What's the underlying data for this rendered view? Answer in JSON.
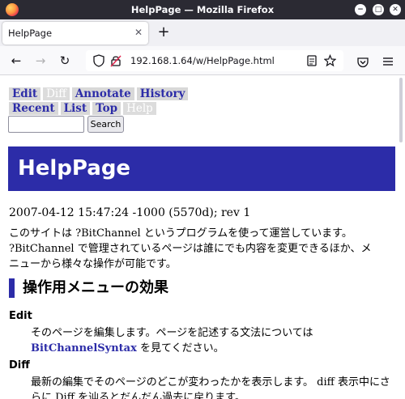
{
  "window": {
    "title": "HelpPage — Mozilla Firefox",
    "minimize_glyph": "−",
    "maximize_glyph": "□",
    "close_glyph": "✕"
  },
  "tabs": [
    {
      "label": "HelpPage",
      "close_glyph": "✕",
      "active": true
    }
  ],
  "new_tab_glyph": "+",
  "nav": {
    "back_glyph": "←",
    "forward_glyph": "→",
    "reload_glyph": "↻",
    "url": "192.168.1.64/w/HelpPage.html"
  },
  "menu": {
    "row1": [
      {
        "label": "Edit",
        "enabled": true
      },
      {
        "label": "Diff",
        "enabled": false
      },
      {
        "label": "Annotate",
        "enabled": true
      },
      {
        "label": "History",
        "enabled": true
      }
    ],
    "row2": [
      {
        "label": "Recent",
        "enabled": true
      },
      {
        "label": "List",
        "enabled": true
      },
      {
        "label": "Top",
        "enabled": true
      },
      {
        "label": "Help",
        "enabled": false
      }
    ]
  },
  "search": {
    "value": "",
    "button_label": "Search"
  },
  "page": {
    "heading": "HelpPage",
    "meta": "2007-04-12 15:47:24 -1000 (5570d); rev 1",
    "intro_line1": "このサイトは ?BitChannel というプログラムを使って運営しています。",
    "intro_line2": "?BitChannel で管理されているページは誰にでも内容を変更できるほか、メ",
    "intro_line3": "ニューから様々な操作が可能です。",
    "section_title": "操作用メニューの効果",
    "items": [
      {
        "term": "Edit",
        "desc_line1": "そのページを編集します。ページを記述する文法については",
        "desc_link": "BitChannelSyntax",
        "desc_line2_rest": " を見てください。"
      },
      {
        "term": "Diff",
        "desc_line1": "最新の編集でそのページのどこが変わったかを表示します。 diff 表示中にさ",
        "desc_line2": "らに Diff を辿るとだんだん過去に戻ります。"
      }
    ]
  },
  "colors": {
    "accent": "#2c2ca8",
    "menu_bg": "#d8d8d8",
    "titlebar": "#2b2a33",
    "toolbar": "#f9f9fb"
  }
}
